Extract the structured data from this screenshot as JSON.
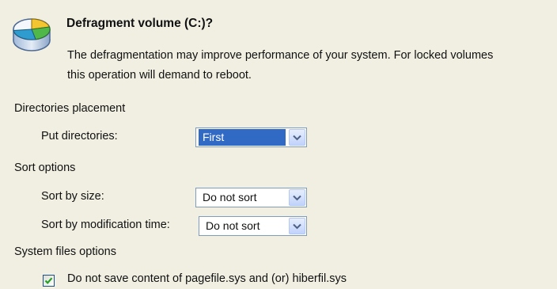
{
  "header": {
    "icon": "disk-volume-icon",
    "title": "Defragment volume (C:)?",
    "description": "The defragmentation may improve performance of your system. For locked volumes\nthis operation will demand to reboot."
  },
  "directories_placement": {
    "section_label": "Directories placement",
    "put_directories": {
      "label": "Put directories:",
      "value": "First"
    }
  },
  "sort_options": {
    "section_label": "Sort options",
    "sort_by_size": {
      "label": "Sort by size:",
      "value": "Do not sort"
    },
    "sort_by_modification_time": {
      "label": "Sort by modification time:",
      "value": "Do not sort"
    }
  },
  "system_files_options": {
    "section_label": "System files options",
    "skip_pagefile": {
      "label": "Do not save content of pagefile.sys and (or) hiberfil.sys",
      "checked": true
    }
  },
  "colors": {
    "panel_background": "#f1efe2",
    "selection_highlight": "#316ac5",
    "checkmark": "#21a121"
  }
}
